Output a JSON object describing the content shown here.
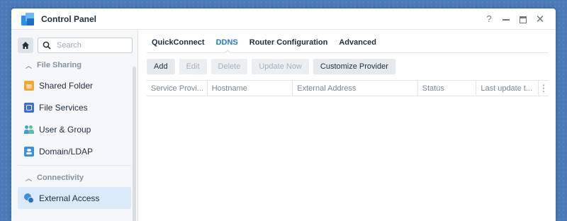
{
  "window": {
    "title": "Control Panel",
    "help": "?",
    "close": "✕"
  },
  "sidebar": {
    "search_placeholder": "Search",
    "sections": [
      {
        "label": "File Sharing",
        "items": [
          {
            "label": "Shared Folder",
            "icon": "shared-folder-icon"
          },
          {
            "label": "File Services",
            "icon": "file-services-icon"
          },
          {
            "label": "User & Group",
            "icon": "user-group-icon"
          },
          {
            "label": "Domain/LDAP",
            "icon": "domain-ldap-icon"
          }
        ]
      },
      {
        "label": "Connectivity",
        "items": [
          {
            "label": "External Access",
            "icon": "external-access-icon",
            "active": true
          }
        ]
      }
    ]
  },
  "main": {
    "tabs": [
      "QuickConnect",
      "DDNS",
      "Router Configuration",
      "Advanced"
    ],
    "active_tab": "DDNS",
    "toolbar": {
      "add": "Add",
      "edit": "Edit",
      "delete": "Delete",
      "update_now": "Update Now",
      "customize_provider": "Customize Provider"
    },
    "columns": [
      "Service Provi...",
      "Hostname",
      "External Address",
      "Status",
      "Last update t..."
    ],
    "menu_glyph": "⋮"
  },
  "colors": {
    "accent": "#1a7bd8",
    "active_bg": "#dbeaf8",
    "desktop": "#4a7bb8"
  }
}
